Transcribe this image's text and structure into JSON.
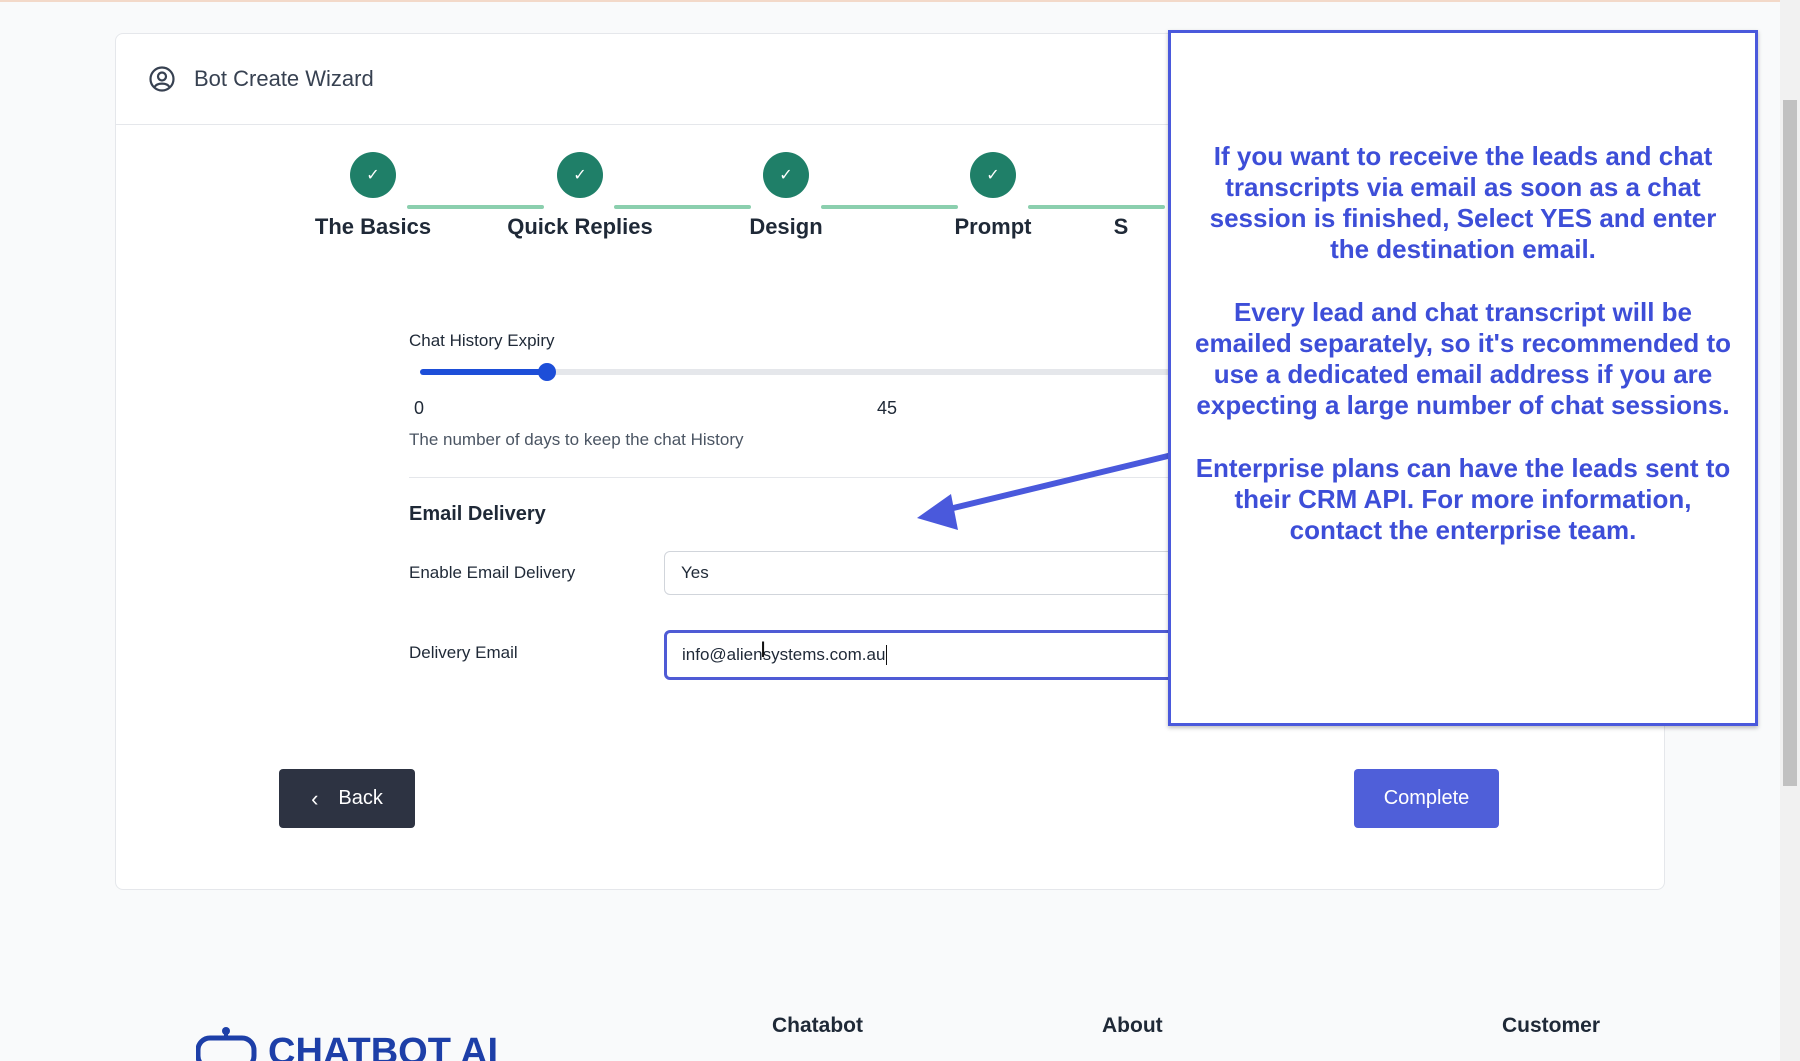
{
  "colors": {
    "accent": "#4f5fd9",
    "step_done": "#1f7f68",
    "callout_text": "#3d4ed8"
  },
  "header": {
    "title": "Bot Create Wizard",
    "icon": "user-circle-icon"
  },
  "steps": [
    {
      "label": "The Basics",
      "status": "done"
    },
    {
      "label": "Quick Replies",
      "status": "done"
    },
    {
      "label": "Design",
      "status": "done"
    },
    {
      "label": "Prompt",
      "status": "done"
    },
    {
      "label": "S",
      "status": "done"
    }
  ],
  "chat_history": {
    "label": "Chat History Expiry",
    "value": 15,
    "min": 0,
    "max": 90,
    "tick_min": "0",
    "tick_mid": "45",
    "help": "The number of days to keep the chat History"
  },
  "email_delivery": {
    "section_title": "Email Delivery",
    "enable_label": "Enable Email Delivery",
    "enable_value": "Yes",
    "email_label": "Delivery Email",
    "email_value": "info@aliensystems.com.au"
  },
  "buttons": {
    "back": "Back",
    "complete": "Complete"
  },
  "callout": {
    "p1": "If you want to receive the leads and chat transcripts via email as soon as a chat session is finished, Select YES and enter the destination email.",
    "p2": "Every lead and chat transcript will be emailed separately, so it's recommended to use a dedicated email address if you are expecting a large number of chat sessions.",
    "p3": "Enterprise plans can have the leads sent to their CRM API. For more information, contact the enterprise team."
  },
  "footer": {
    "logo_text": "CHATBOT AI",
    "col1": "Chatabot",
    "col2": "About",
    "col3": "Customer"
  }
}
